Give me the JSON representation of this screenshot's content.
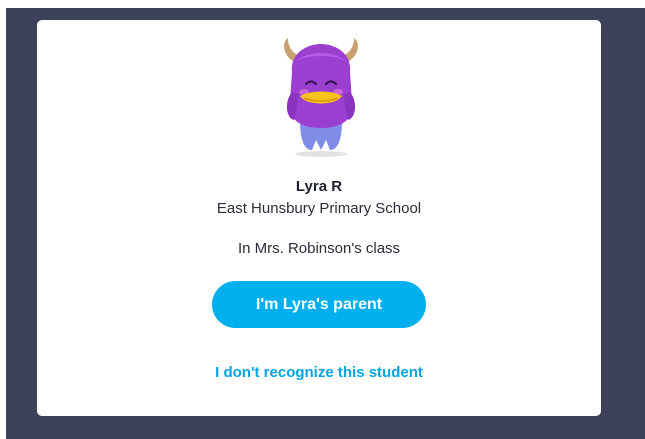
{
  "student": {
    "name": "Lyra R",
    "school": "East Hunsbury Primary School",
    "class": "In Mrs. Robinson's class",
    "avatar_icon": "purple-monster-avatar-icon"
  },
  "actions": {
    "parent_button_label": "I'm Lyra's parent",
    "not_recognize_label": "I don't recognize this student"
  },
  "colors": {
    "backdrop": "#3d4159",
    "primary_button": "#00b0ee",
    "link": "#00a5e3",
    "avatar_body": "#9b3fd1",
    "avatar_belly": "#7f8de8",
    "avatar_beak": "#f6c21c"
  }
}
